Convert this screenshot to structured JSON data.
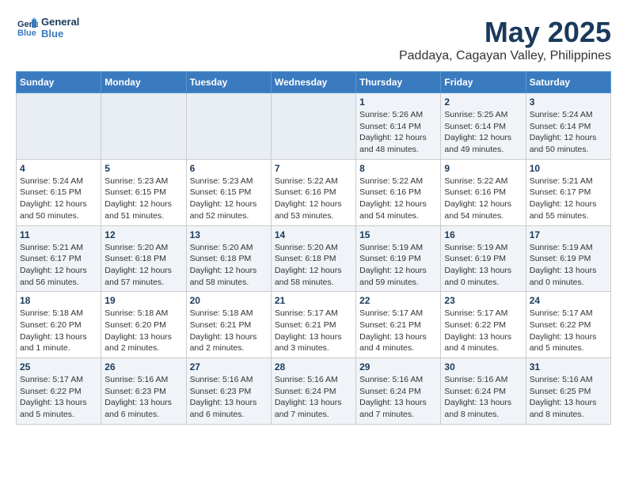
{
  "logo": {
    "line1": "General",
    "line2": "Blue"
  },
  "title": "May 2025",
  "subtitle": "Paddaya, Cagayan Valley, Philippines",
  "weekdays": [
    "Sunday",
    "Monday",
    "Tuesday",
    "Wednesday",
    "Thursday",
    "Friday",
    "Saturday"
  ],
  "weeks": [
    [
      {
        "day": "",
        "info": ""
      },
      {
        "day": "",
        "info": ""
      },
      {
        "day": "",
        "info": ""
      },
      {
        "day": "",
        "info": ""
      },
      {
        "day": "1",
        "info": "Sunrise: 5:26 AM\nSunset: 6:14 PM\nDaylight: 12 hours\nand 48 minutes."
      },
      {
        "day": "2",
        "info": "Sunrise: 5:25 AM\nSunset: 6:14 PM\nDaylight: 12 hours\nand 49 minutes."
      },
      {
        "day": "3",
        "info": "Sunrise: 5:24 AM\nSunset: 6:14 PM\nDaylight: 12 hours\nand 50 minutes."
      }
    ],
    [
      {
        "day": "4",
        "info": "Sunrise: 5:24 AM\nSunset: 6:15 PM\nDaylight: 12 hours\nand 50 minutes."
      },
      {
        "day": "5",
        "info": "Sunrise: 5:23 AM\nSunset: 6:15 PM\nDaylight: 12 hours\nand 51 minutes."
      },
      {
        "day": "6",
        "info": "Sunrise: 5:23 AM\nSunset: 6:15 PM\nDaylight: 12 hours\nand 52 minutes."
      },
      {
        "day": "7",
        "info": "Sunrise: 5:22 AM\nSunset: 6:16 PM\nDaylight: 12 hours\nand 53 minutes."
      },
      {
        "day": "8",
        "info": "Sunrise: 5:22 AM\nSunset: 6:16 PM\nDaylight: 12 hours\nand 54 minutes."
      },
      {
        "day": "9",
        "info": "Sunrise: 5:22 AM\nSunset: 6:16 PM\nDaylight: 12 hours\nand 54 minutes."
      },
      {
        "day": "10",
        "info": "Sunrise: 5:21 AM\nSunset: 6:17 PM\nDaylight: 12 hours\nand 55 minutes."
      }
    ],
    [
      {
        "day": "11",
        "info": "Sunrise: 5:21 AM\nSunset: 6:17 PM\nDaylight: 12 hours\nand 56 minutes."
      },
      {
        "day": "12",
        "info": "Sunrise: 5:20 AM\nSunset: 6:18 PM\nDaylight: 12 hours\nand 57 minutes."
      },
      {
        "day": "13",
        "info": "Sunrise: 5:20 AM\nSunset: 6:18 PM\nDaylight: 12 hours\nand 58 minutes."
      },
      {
        "day": "14",
        "info": "Sunrise: 5:20 AM\nSunset: 6:18 PM\nDaylight: 12 hours\nand 58 minutes."
      },
      {
        "day": "15",
        "info": "Sunrise: 5:19 AM\nSunset: 6:19 PM\nDaylight: 12 hours\nand 59 minutes."
      },
      {
        "day": "16",
        "info": "Sunrise: 5:19 AM\nSunset: 6:19 PM\nDaylight: 13 hours\nand 0 minutes."
      },
      {
        "day": "17",
        "info": "Sunrise: 5:19 AM\nSunset: 6:19 PM\nDaylight: 13 hours\nand 0 minutes."
      }
    ],
    [
      {
        "day": "18",
        "info": "Sunrise: 5:18 AM\nSunset: 6:20 PM\nDaylight: 13 hours\nand 1 minute."
      },
      {
        "day": "19",
        "info": "Sunrise: 5:18 AM\nSunset: 6:20 PM\nDaylight: 13 hours\nand 2 minutes."
      },
      {
        "day": "20",
        "info": "Sunrise: 5:18 AM\nSunset: 6:21 PM\nDaylight: 13 hours\nand 2 minutes."
      },
      {
        "day": "21",
        "info": "Sunrise: 5:17 AM\nSunset: 6:21 PM\nDaylight: 13 hours\nand 3 minutes."
      },
      {
        "day": "22",
        "info": "Sunrise: 5:17 AM\nSunset: 6:21 PM\nDaylight: 13 hours\nand 4 minutes."
      },
      {
        "day": "23",
        "info": "Sunrise: 5:17 AM\nSunset: 6:22 PM\nDaylight: 13 hours\nand 4 minutes."
      },
      {
        "day": "24",
        "info": "Sunrise: 5:17 AM\nSunset: 6:22 PM\nDaylight: 13 hours\nand 5 minutes."
      }
    ],
    [
      {
        "day": "25",
        "info": "Sunrise: 5:17 AM\nSunset: 6:22 PM\nDaylight: 13 hours\nand 5 minutes."
      },
      {
        "day": "26",
        "info": "Sunrise: 5:16 AM\nSunset: 6:23 PM\nDaylight: 13 hours\nand 6 minutes."
      },
      {
        "day": "27",
        "info": "Sunrise: 5:16 AM\nSunset: 6:23 PM\nDaylight: 13 hours\nand 6 minutes."
      },
      {
        "day": "28",
        "info": "Sunrise: 5:16 AM\nSunset: 6:24 PM\nDaylight: 13 hours\nand 7 minutes."
      },
      {
        "day": "29",
        "info": "Sunrise: 5:16 AM\nSunset: 6:24 PM\nDaylight: 13 hours\nand 7 minutes."
      },
      {
        "day": "30",
        "info": "Sunrise: 5:16 AM\nSunset: 6:24 PM\nDaylight: 13 hours\nand 8 minutes."
      },
      {
        "day": "31",
        "info": "Sunrise: 5:16 AM\nSunset: 6:25 PM\nDaylight: 13 hours\nand 8 minutes."
      }
    ]
  ]
}
